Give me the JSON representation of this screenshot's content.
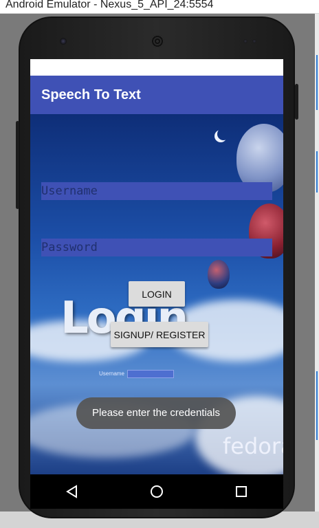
{
  "emulator": {
    "window_title": "Android Emulator - Nexus_5_API_24:5554"
  },
  "app": {
    "title": "Speech To Text"
  },
  "form": {
    "username_placeholder": "Username",
    "username_value": "",
    "password_placeholder": "Password",
    "password_value": "",
    "login_label": "LOGIN",
    "signup_label": "SIGNUP/ REGISTER"
  },
  "toast": {
    "message": "Please enter the credentials"
  },
  "background_art": {
    "login_text": "Login",
    "brand_text": "fedora",
    "mini_field_label": "Username"
  },
  "navigation": {
    "back_icon": "back-triangle-icon",
    "home_icon": "home-circle-icon",
    "recents_icon": "recents-square-icon"
  },
  "colors": {
    "app_bar": "#3f51b5",
    "field": "#3f51b5",
    "button": "#dcdcdc",
    "toast": "#555555"
  }
}
